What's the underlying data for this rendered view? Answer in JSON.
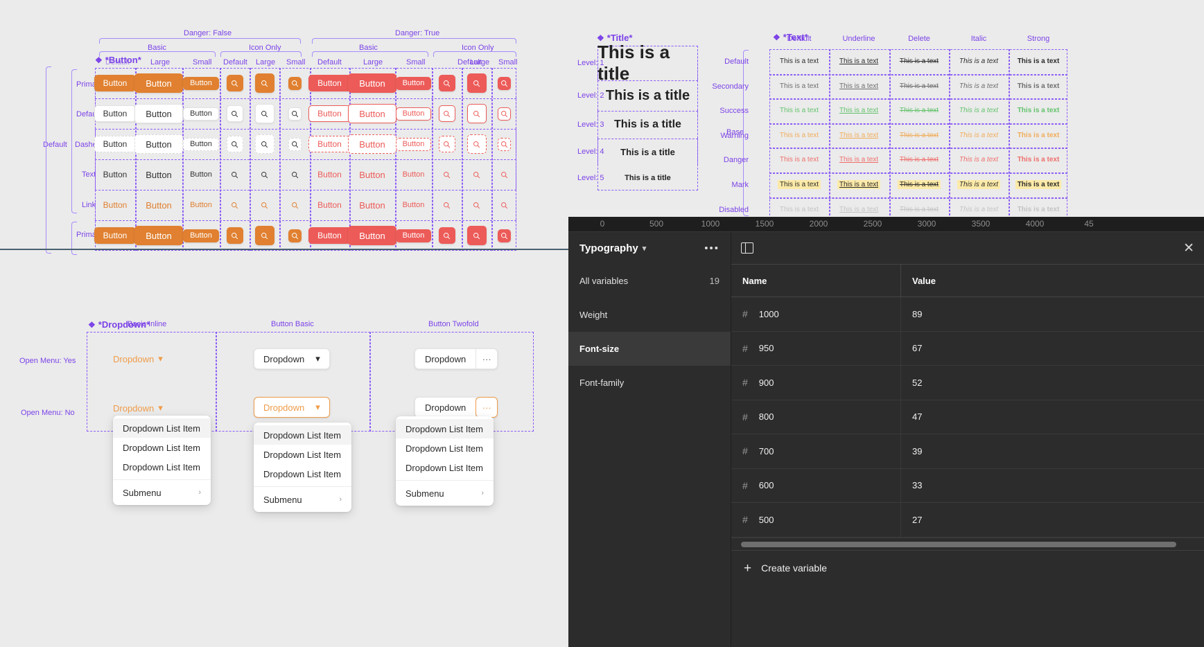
{
  "components": {
    "button": {
      "name": "*Button*",
      "groups": [
        {
          "label": "Danger: False"
        },
        {
          "label": "Danger: True"
        }
      ],
      "col_groups": [
        "Basic",
        "Icon Only",
        "Basic",
        "Icon Only"
      ],
      "sizes": [
        "Default",
        "Large",
        "Small"
      ],
      "row_group": "Default",
      "rows": [
        "Primary",
        "Default",
        "Dashed",
        "Text",
        "Link",
        "Primary"
      ],
      "label": "Button",
      "icon": "search-icon"
    },
    "title": {
      "name": "*Title*",
      "levels": [
        "Level: 1",
        "Level: 2",
        "Level: 3",
        "Level: 4",
        "Level: 5"
      ],
      "text": "This is a title",
      "sizes": [
        26,
        20,
        16,
        13,
        11
      ]
    },
    "text": {
      "name": "*Text*",
      "group": "Base",
      "columns": [
        "Default",
        "Underline",
        "Delete",
        "Italic",
        "Strong"
      ],
      "rows": [
        "Default",
        "Secondary",
        "Success",
        "Warning",
        "Danger",
        "Mark",
        "Disabled"
      ],
      "text": "This is a text"
    },
    "dropdown": {
      "name": "*Dropdown*",
      "columns": [
        "Basic Inline",
        "Button Basic",
        "Button Twofold"
      ],
      "rows": [
        "Open Menu: Yes",
        "Open Menu: No"
      ],
      "label": "Dropdown",
      "more_label": "···",
      "menu_items": [
        "Dropdown List Item",
        "Dropdown List Item",
        "Dropdown List Item"
      ],
      "submenu_label": "Submenu",
      "submenu_chevron": "chevron-right-icon"
    }
  },
  "variables_panel": {
    "ruler_ticks": [
      "0",
      "500",
      "1000",
      "1500",
      "2000",
      "2500",
      "3000",
      "3500",
      "4000",
      "45"
    ],
    "collection": "Typography",
    "collection_chevron": "chevron-down-icon",
    "more_menu": "•••",
    "panel_toggle_icon": "panel-layout-icon",
    "close_icon": "close-icon",
    "groups": [
      {
        "label": "All variables",
        "count": "19",
        "selected": false
      },
      {
        "label": "Weight",
        "count": "",
        "selected": false
      },
      {
        "label": "Font-size",
        "count": "",
        "selected": true
      },
      {
        "label": "Font-family",
        "count": "",
        "selected": false
      }
    ],
    "table": {
      "headers": [
        "Name",
        "Value"
      ],
      "rows": [
        {
          "icon": "number-icon",
          "name": "1000",
          "value": "89"
        },
        {
          "icon": "number-icon",
          "name": "950",
          "value": "67"
        },
        {
          "icon": "number-icon",
          "name": "900",
          "value": "52"
        },
        {
          "icon": "number-icon",
          "name": "800",
          "value": "47"
        },
        {
          "icon": "number-icon",
          "name": "700",
          "value": "39"
        },
        {
          "icon": "number-icon",
          "name": "600",
          "value": "33"
        },
        {
          "icon": "number-icon",
          "name": "500",
          "value": "27"
        }
      ]
    },
    "create_label": "Create variable",
    "create_icon": "plus-icon"
  },
  "colors": {
    "accent_purple": "#7b42e8",
    "frame_purple": "#8b5cf6",
    "primary_orange": "#e08030",
    "danger_red": "#ec5b58",
    "panel_bg": "#2c2c2c",
    "canvas_bg": "#ebebeb"
  }
}
